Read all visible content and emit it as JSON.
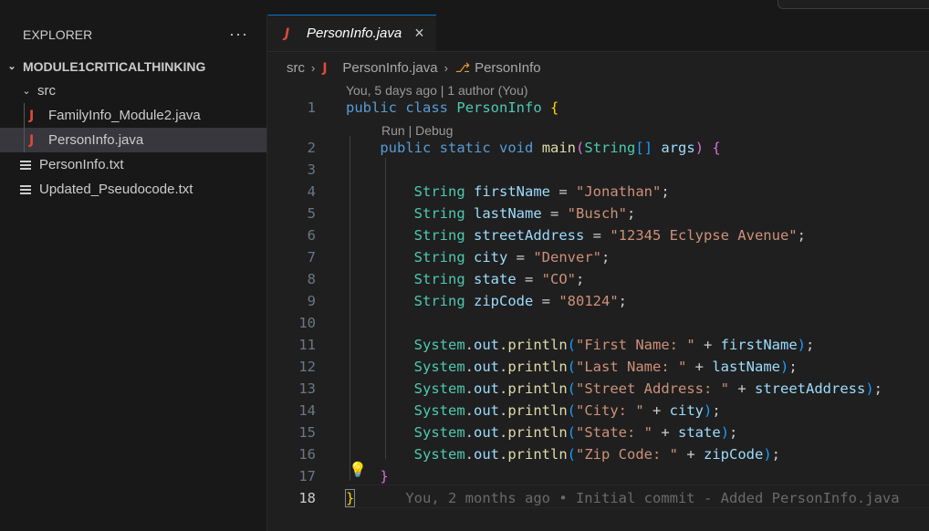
{
  "sidebar": {
    "title": "EXPLORER",
    "more": "···",
    "root": "MODULE1CRITICALTHINKING",
    "folder": "src",
    "files": [
      {
        "name": "FamilyInfo_Module2.java",
        "icon": "J"
      },
      {
        "name": "PersonInfo.java",
        "icon": "J"
      }
    ],
    "root_files": [
      {
        "name": "PersonInfo.txt"
      },
      {
        "name": "Updated_Pseudocode.txt"
      }
    ]
  },
  "tab": {
    "label": "PersonInfo.java",
    "icon": "J",
    "close": "×"
  },
  "breadcrumb": {
    "items": [
      "src",
      "PersonInfo.java",
      "PersonInfo"
    ],
    "sep": "›"
  },
  "codelens": {
    "blame": "You, 5 days ago | 1 author (You)",
    "run": "Run | Debug"
  },
  "code": {
    "line_numbers": [
      "1",
      "2",
      "3",
      "4",
      "5",
      "6",
      "7",
      "8",
      "9",
      "10",
      "11",
      "12",
      "13",
      "14",
      "15",
      "16",
      "17",
      "18"
    ],
    "l1": {
      "kw1": "public",
      "kw2": "class",
      "type": "PersonInfo",
      "brace": "{"
    },
    "l2": {
      "kw1": "public",
      "kw2": "static",
      "kw3": "void",
      "fn": "main",
      "p1": "(",
      "type": "String",
      "arr": "[]",
      "arg": "args",
      "p2": ")",
      "brace": "{"
    },
    "decls": [
      {
        "type": "String",
        "name": "firstName",
        "eq": " = ",
        "value": "\"Jonathan\"",
        "end": ";"
      },
      {
        "type": "String",
        "name": "lastName",
        "eq": " = ",
        "value": "\"Busch\"",
        "end": ";"
      },
      {
        "type": "String",
        "name": "streetAddress",
        "eq": " = ",
        "value": "\"12345 Eclypse Avenue\"",
        "end": ";"
      },
      {
        "type": "String",
        "name": "city",
        "eq": " = ",
        "value": "\"Denver\"",
        "end": ";"
      },
      {
        "type": "String",
        "name": "state",
        "eq": " = ",
        "value": "\"CO\"",
        "end": ";"
      },
      {
        "type": "String",
        "name": "zipCode",
        "eq": " = ",
        "value": "\"80124\"",
        "end": ";"
      }
    ],
    "prints": [
      {
        "cls": "System",
        "out": "out",
        "fn": "println",
        "str": "\"First Name: \"",
        "var": "firstName"
      },
      {
        "cls": "System",
        "out": "out",
        "fn": "println",
        "str": "\"Last Name: \"",
        "var": "lastName"
      },
      {
        "cls": "System",
        "out": "out",
        "fn": "println",
        "str": "\"Street Address: \"",
        "var": "streetAddress"
      },
      {
        "cls": "System",
        "out": "out",
        "fn": "println",
        "str": "\"City: \"",
        "var": "city"
      },
      {
        "cls": "System",
        "out": "out",
        "fn": "println",
        "str": "\"State: \"",
        "var": "state"
      },
      {
        "cls": "System",
        "out": "out",
        "fn": "println",
        "str": "\"Zip Code: \"",
        "var": "zipCode"
      }
    ],
    "close_method": "}",
    "close_class": "}",
    "ghost_blame": "You, 2 months ago • Initial commit - Added PersonInfo.java"
  }
}
